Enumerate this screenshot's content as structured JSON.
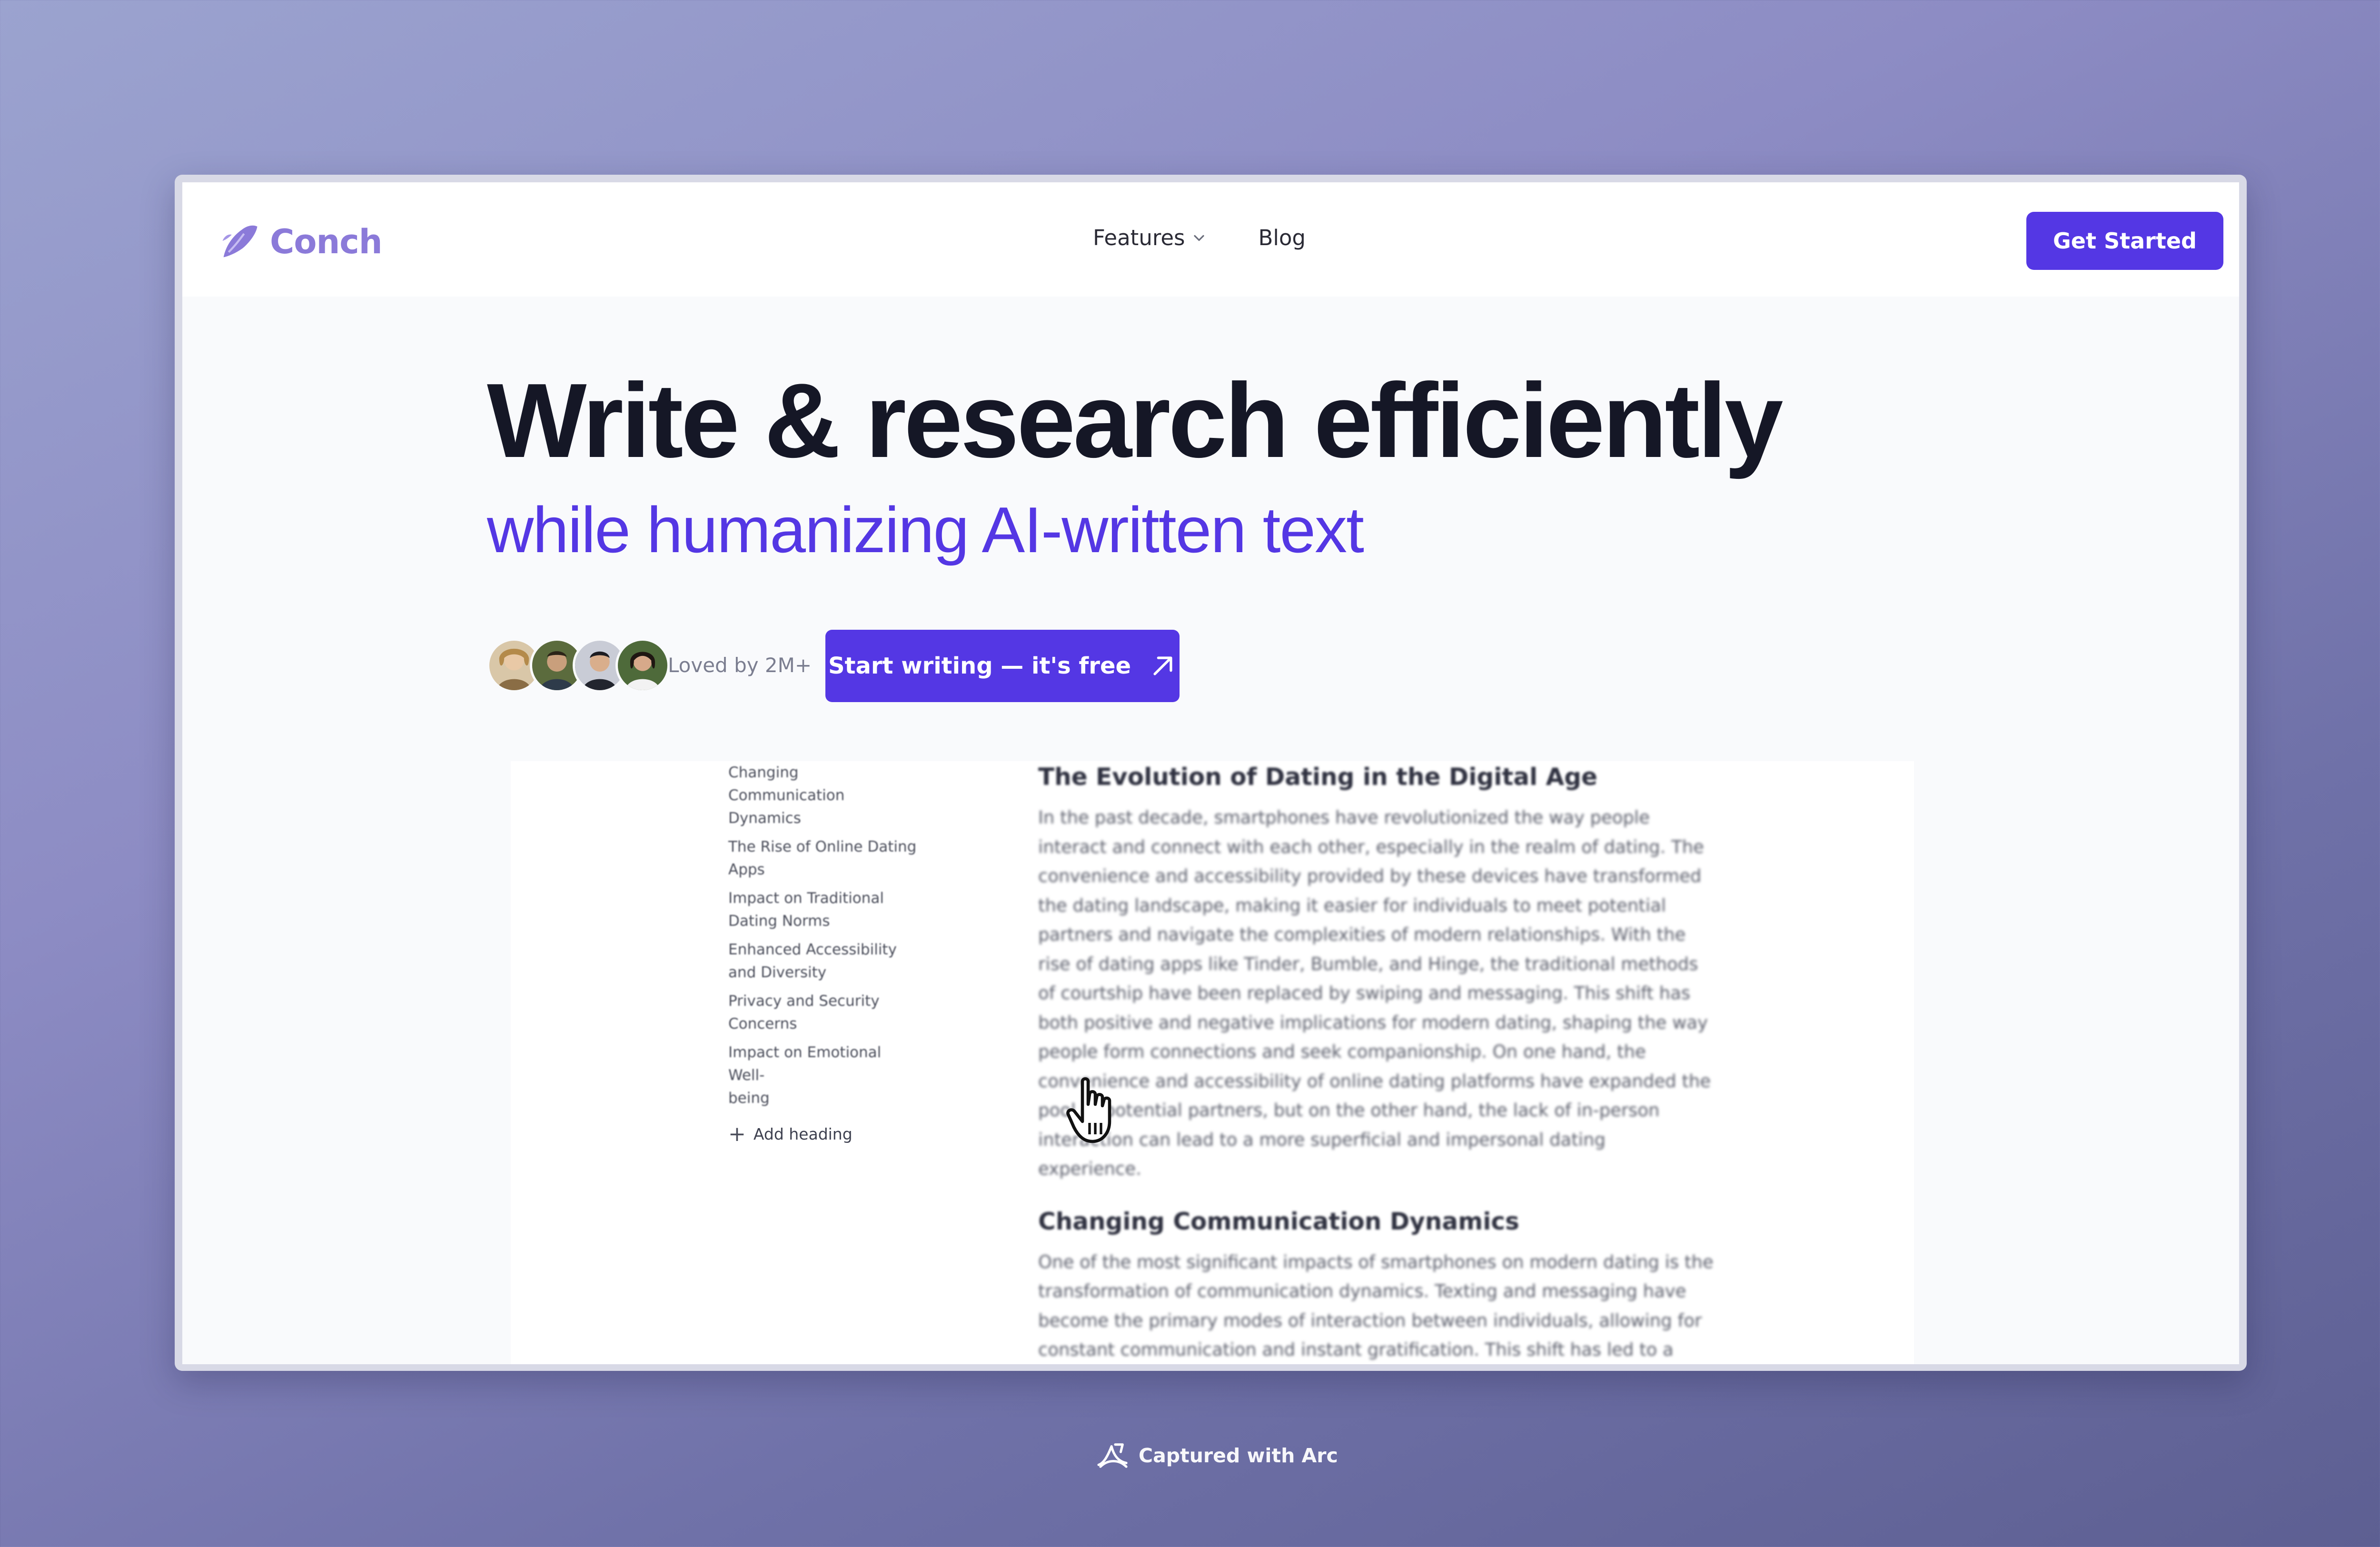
{
  "colors": {
    "accent": "#5437e4",
    "logo": "#8b7ad9",
    "background_top": "#9ba3cf",
    "background_bottom": "#5d5f92"
  },
  "header": {
    "logo_icon": "conch-shell-icon",
    "brand": "Conch",
    "nav": [
      {
        "label": "Features",
        "icon": "chevron-down-icon"
      },
      {
        "label": "Blog"
      }
    ],
    "cta": "Get Started"
  },
  "hero": {
    "title": "Write & research efficiently",
    "subtitle": "while humanizing AI-written text",
    "social_proof": "Loved by 2M+",
    "cta": "Start writing — it's free",
    "cta_icon": "arrow-up-right-icon"
  },
  "editor": {
    "toc": [
      "Changing Communication\nDynamics",
      "The Rise of Online Dating\nApps",
      "Impact on Traditional\nDating Norms",
      "Enhanced Accessibility\nand Diversity",
      "Privacy and Security\nConcerns",
      "Impact on Emotional Well-\nbeing"
    ],
    "add_heading": "Add heading",
    "article_title": "The Evolution of Dating in the Digital Age",
    "paragraph_1": "In the past decade, smartphones have revolutionized the way people interact and connect with each other, especially in the realm of dating. The convenience and accessibility provided by these devices have transformed the dating landscape, making it easier for individuals to meet potential partners and navigate the complexities of modern relationships. With the rise of dating apps like Tinder, Bumble, and Hinge, the traditional methods of courtship have been replaced by swiping and messaging. This shift has both positive and negative implications for modern dating, shaping the way people form connections and seek companionship. On one hand, the convenience and accessibility of online dating platforms have expanded the pool of potential partners, but on the other hand, the lack of in-person interaction can lead to a more superficial and impersonal dating experience.",
    "section_heading": "Changing Communication Dynamics",
    "paragraph_2": "One of the most significant impacts of smartphones on modern dating is the transformation of communication dynamics. Texting and messaging have become the primary modes of interaction between individuals, allowing for constant communication and instant gratification. This shift has led to a decrease in face-to-face conversations and an increase in virtual interactions, changing the way people express their emotions and build"
  },
  "footer": {
    "icon": "arc-logo-icon",
    "text": "Captured with Arc"
  }
}
